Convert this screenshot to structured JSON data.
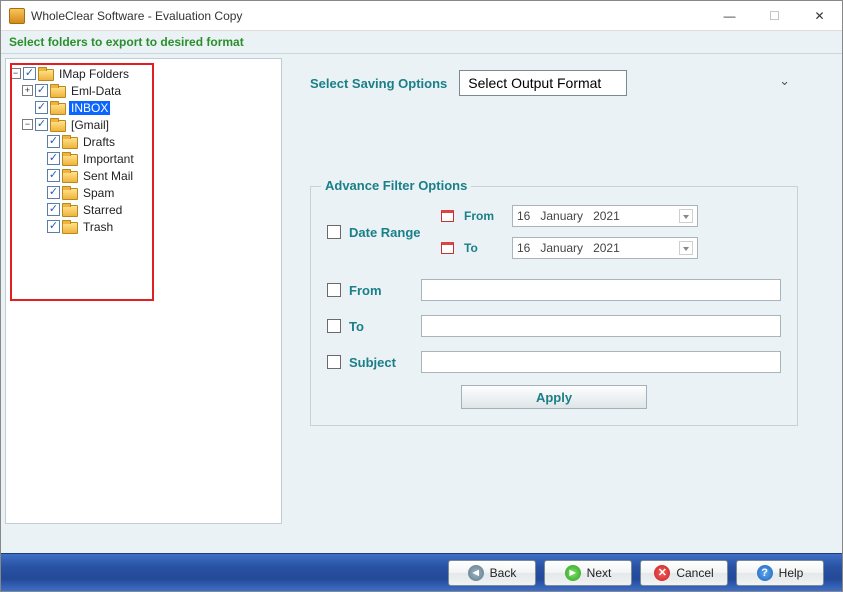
{
  "window": {
    "title": "WholeClear Software - Evaluation Copy"
  },
  "subheader": "Select folders to export to desired format",
  "tree": {
    "root": {
      "label": "IMap Folders",
      "expanded": true,
      "checked": true
    },
    "children": [
      {
        "label": "Eml-Data",
        "expanded": false,
        "checked": true
      },
      {
        "label": "INBOX",
        "expanded": null,
        "checked": true,
        "selected": true
      },
      {
        "label": "[Gmail]",
        "expanded": true,
        "checked": true,
        "children": [
          {
            "label": "Drafts",
            "checked": true
          },
          {
            "label": "Important",
            "checked": true
          },
          {
            "label": "Sent Mail",
            "checked": true
          },
          {
            "label": "Spam",
            "checked": true
          },
          {
            "label": "Starred",
            "checked": true
          },
          {
            "label": "Trash",
            "checked": true
          }
        ]
      }
    ]
  },
  "saving": {
    "label": "Select Saving Options",
    "select_placeholder": "Select Output Format"
  },
  "filter": {
    "legend": "Advance Filter Options",
    "date_range_label": "Date Range",
    "from_label": "From",
    "to_label": "To",
    "subject_label": "Subject",
    "date_from_small": "From",
    "date_to_small": "To",
    "date_from": {
      "day": "16",
      "month": "January",
      "year": "2021"
    },
    "date_to": {
      "day": "16",
      "month": "January",
      "year": "2021"
    },
    "apply_label": "Apply"
  },
  "buttons": {
    "back": "Back",
    "next": "Next",
    "cancel": "Cancel",
    "help": "Help"
  }
}
